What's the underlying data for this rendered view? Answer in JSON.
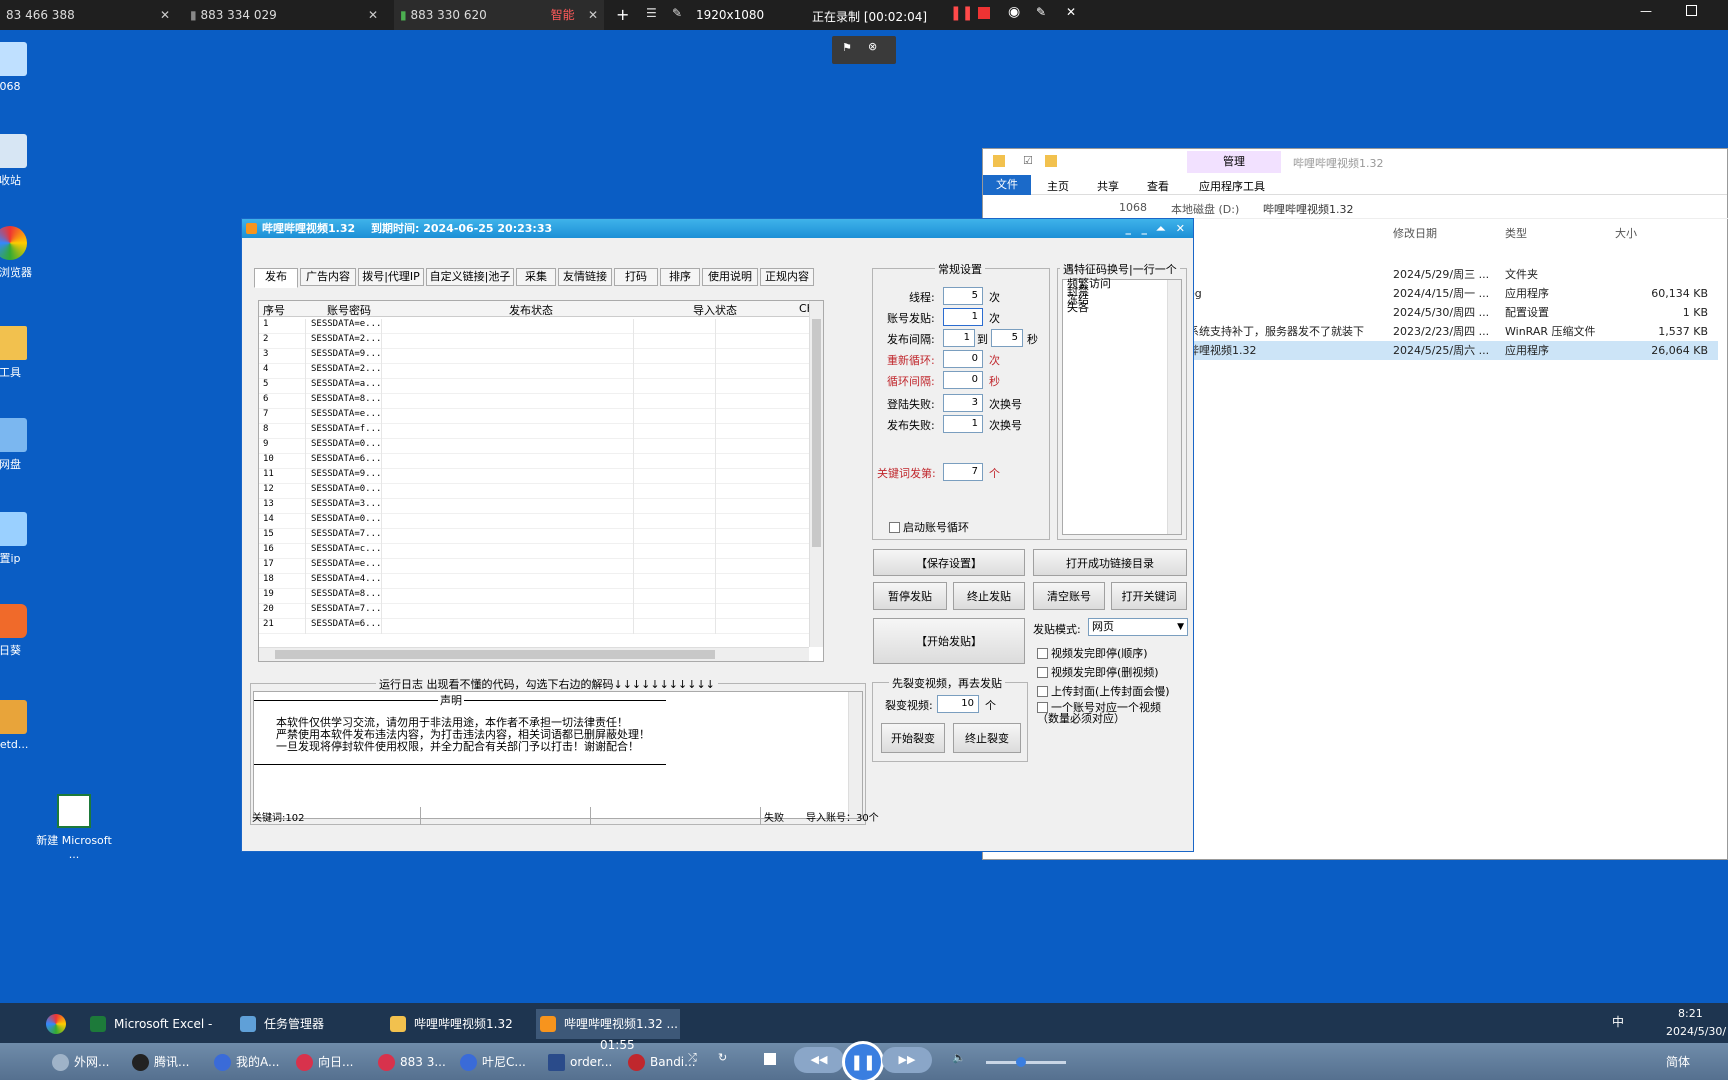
{
  "top_tabs": [
    {
      "label": "83 466 388"
    },
    {
      "label": "883 334 029"
    },
    {
      "label": "883 330 620",
      "badge": "智能"
    }
  ],
  "recorder": {
    "resolution": "1920x1080",
    "status": "正在录制 [00:02:04]"
  },
  "desktop_icons": [
    {
      "label": "068"
    },
    {
      "label": "收站"
    },
    {
      "label": "速浏览器"
    },
    {
      "label": "工具"
    },
    {
      "label": "网盘"
    },
    {
      "label": "置ip"
    },
    {
      "label": "日葵"
    },
    {
      "label": "Netd..."
    },
    {
      "label": "新建 Microsoft ..."
    }
  ],
  "explorer": {
    "ribbon_tabs": [
      "文件",
      "主页",
      "共享",
      "查看"
    ],
    "manage_tab": "管理",
    "app_tools": "应用程序工具",
    "title": "哔哩哔哩视频1.32",
    "breadcrumb": [
      "1068",
      "本地磁盘 (D:)",
      "哔哩哔哩视频1.32"
    ],
    "columns": [
      "修改日期",
      "类型",
      "大小"
    ],
    "rows": [
      {
        "name": "",
        "date": "2024/5/29/周三 ...",
        "type": "文件夹",
        "size": ""
      },
      {
        "name": "eg",
        "date": "2024/4/15/周一 ...",
        "type": "应用程序",
        "size": "60,134 KB"
      },
      {
        "name": "",
        "date": "2024/5/30/周四 ...",
        "type": "配置设置",
        "size": "1 KB"
      },
      {
        "name": "系统支持补丁，服务器发不了就装下",
        "date": "2023/2/23/周四 ...",
        "type": "WinRAR 压缩文件",
        "size": "1,537 KB"
      },
      {
        "name": "哔哩视频1.32",
        "date": "2024/5/25/周六 ...",
        "type": "应用程序",
        "size": "26,064 KB"
      }
    ]
  },
  "app": {
    "title": "哔哩哔哩视频1.32",
    "expiry": "到期时间: 2024-06-25 20:23:33",
    "tabs": [
      "发布",
      "广告内容",
      "拨号|代理IP",
      "自定义链接|池子",
      "采集",
      "友情链接",
      "打码",
      "排序",
      "使用说明",
      "正规内容"
    ],
    "grid": {
      "headers": [
        "序号",
        "账号密码",
        "发布状态",
        "导入状态",
        "CK"
      ],
      "rows": [
        [
          "1",
          "SESSDATA=e..."
        ],
        [
          "2",
          "SESSDATA=2..."
        ],
        [
          "3",
          "SESSDATA=9..."
        ],
        [
          "4",
          "SESSDATA=2..."
        ],
        [
          "5",
          "SESSDATA=a..."
        ],
        [
          "6",
          "SESSDATA=8..."
        ],
        [
          "7",
          "SESSDATA=e..."
        ],
        [
          "8",
          "SESSDATA=f..."
        ],
        [
          "9",
          "SESSDATA=0..."
        ],
        [
          "10",
          "SESSDATA=6..."
        ],
        [
          "11",
          "SESSDATA=9..."
        ],
        [
          "12",
          "SESSDATA=0..."
        ],
        [
          "13",
          "SESSDATA=3..."
        ],
        [
          "14",
          "SESSDATA=0..."
        ],
        [
          "15",
          "SESSDATA=7..."
        ],
        [
          "16",
          "SESSDATA=c..."
        ],
        [
          "17",
          "SESSDATA=e..."
        ],
        [
          "18",
          "SESSDATA=4..."
        ],
        [
          "19",
          "SESSDATA=8..."
        ],
        [
          "20",
          "SESSDATA=7..."
        ],
        [
          "21",
          "SESSDATA=6..."
        ]
      ]
    },
    "log": {
      "title": "运行日志 出现看不懂的代码，勾选下右边的解码↓↓↓↓↓↓↓↓↓↓↓",
      "heading": "声明",
      "lines": [
        "本软件仅供学习交流，请勿用于非法用途，本作者不承担一切法律责任！",
        "严禁使用本软件发布违法内容，为打击违法内容，相关词语都已删屏蔽处理！",
        "一旦发现将停封软件使用权限，并全力配合有关部门予以打击！谢谢配合！"
      ]
    },
    "status": {
      "keywords": "关键词:102",
      "fail": "失败",
      "imported": "导入账号：30个"
    },
    "settings": {
      "title": "常规设置",
      "threads_label": "线程:",
      "threads": "5",
      "threads_unit": "次",
      "account_post_label": "账号发贴:",
      "account_post": "1",
      "account_post_unit": "次",
      "interval_label": "发布间隔:",
      "interval_from": "1",
      "interval_to_label": "到",
      "interval_to": "5",
      "interval_unit": "秒",
      "recycle_label": "重新循环:",
      "recycle": "0",
      "recycle_unit": "次",
      "loop_interval_label": "循环间隔:",
      "loop_interval": "0",
      "loop_interval_unit": "秒",
      "login_fail_label": "登陆失败:",
      "login_fail": "3",
      "login_fail_unit": "次换号",
      "post_fail_label": "发布失败:",
      "post_fail": "1",
      "post_fail_unit": "次换号",
      "keyword_post_label": "关键词发第:",
      "keyword_post": "7",
      "keyword_post_unit": "个",
      "enable_loop": "启动账号循环"
    },
    "feature_codes": {
      "title": "遇特征码换号|一行一个",
      "items": [
        "频繁访问",
        "封禁",
        "冻结",
        "失各"
      ]
    },
    "buttons": {
      "save": "【保存设置】",
      "open_success": "打开成功链接目录",
      "pause": "暂停发贴",
      "stop": "终止发贴",
      "clear": "清空账号",
      "open_keywords": "打开关键词",
      "start": "【开始发贴】"
    },
    "mode": {
      "label": "发贴模式:",
      "value": "网页"
    },
    "options": [
      "视频发完即停(顺序)",
      "视频发完即停(删视频)",
      "上传封面(上传封面会慢)",
      "一个账号对应一个视频（数量必须对应）"
    ],
    "split": {
      "title": "先裂变视频，再去发贴",
      "label": "裂变视频:",
      "value": "10",
      "unit": "个",
      "start": "开始裂变",
      "stop": "终止裂变"
    }
  },
  "taskbar": {
    "items": [
      "Microsoft Excel - ...",
      "任务管理器",
      "哔哩哔哩视频1.32",
      "哔哩哔哩视频1.32 ..."
    ],
    "time": "8:21",
    "date": "2024/5/30/",
    "ime": "中"
  },
  "player": {
    "time": "01:55",
    "items": [
      "外网...",
      "腾讯...",
      "我的A...",
      "向日...",
      "883 3...",
      "叶尼C...",
      "order...",
      "Bandi..."
    ],
    "lang": "简体"
  }
}
